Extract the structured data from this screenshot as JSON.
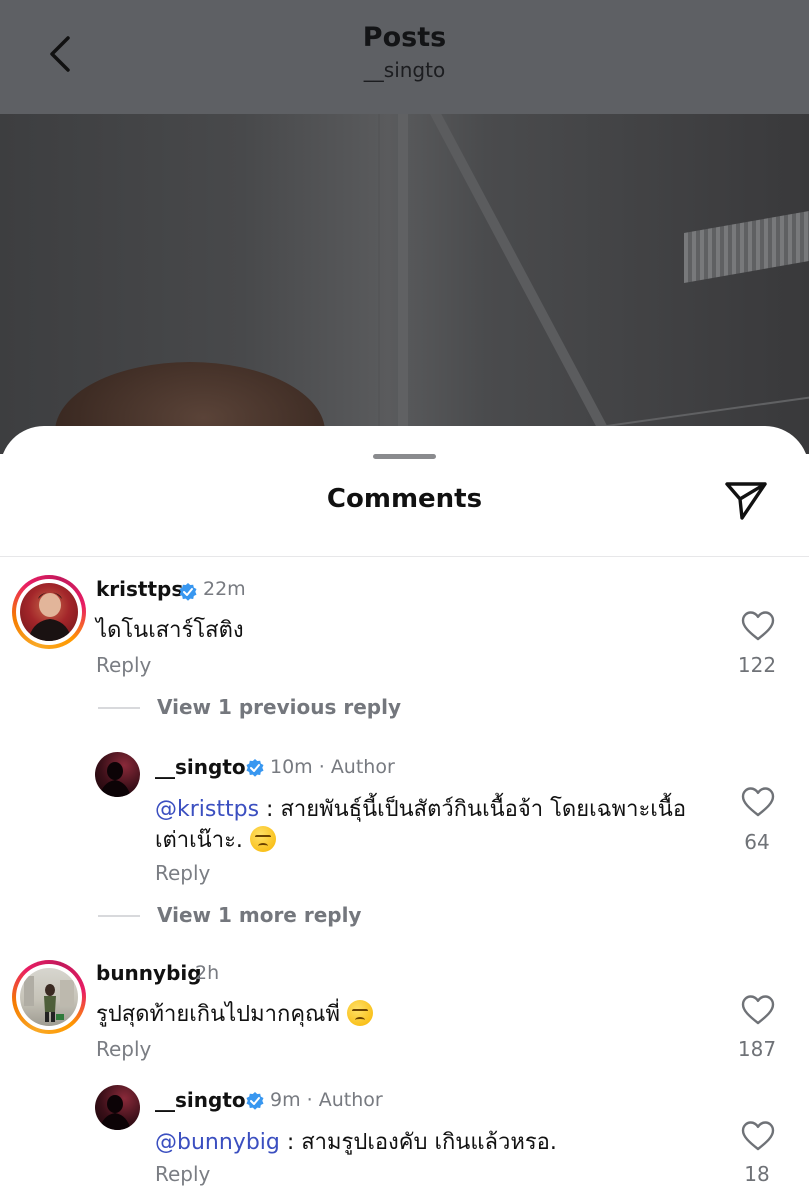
{
  "header": {
    "title": "Posts",
    "subtitle": "__singto",
    "back_icon": "chevron-left-icon"
  },
  "sheet": {
    "title": "Comments",
    "share_icon": "send-icon"
  },
  "comments": [
    {
      "username": "kristtps",
      "verified": true,
      "time": "22m",
      "text": "ไดโนเสาร์โสติง",
      "reply_label": "Reply",
      "likes": "122",
      "view_replies": "View 1 previous reply",
      "replies": [
        {
          "username": "__singto",
          "verified": true,
          "time": "10m",
          "author_tag": "· Author",
          "mention": "@kristtps",
          "text_line1": " : สายพันธุ์นี้เป็นสัตว์กินเนื้อจ้า โดยเฉพาะเนื้อ",
          "text_line2": "เต่าเน๊าะ.",
          "reply_label": "Reply",
          "likes": "64"
        }
      ],
      "view_more": "View 1 more reply"
    },
    {
      "username": "bunnybig",
      "verified": false,
      "time": "2h",
      "text": "รูปสุดท้ายเกินไปมากคุณพี่",
      "reply_label": "Reply",
      "likes": "187",
      "replies": [
        {
          "username": "__singto",
          "verified": true,
          "time": "9m",
          "author_tag": "· Author",
          "mention": "@bunnybig",
          "text_line1": " : สามรูปเองคับ เกินแล้วหรอ.",
          "reply_label": "Reply",
          "likes": "18"
        }
      ]
    }
  ],
  "colors": {
    "mention": "#3b4fc0",
    "verified_badge": "#3897f0",
    "story_ring_start": "#f9a825",
    "story_ring_end": "#c2185b"
  }
}
